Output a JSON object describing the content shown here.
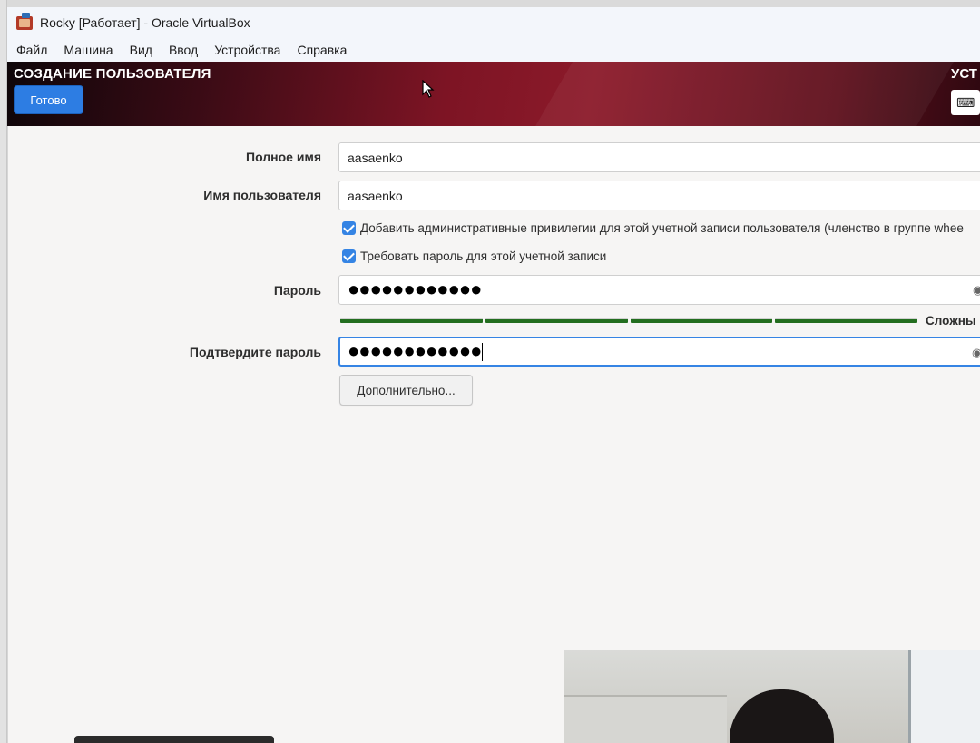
{
  "window": {
    "title": "Rocky [Работает] - Oracle VirtualBox",
    "icon": "virtualbox-icon"
  },
  "menubar": {
    "items": [
      "Файл",
      "Машина",
      "Вид",
      "Ввод",
      "Устройства",
      "Справка"
    ]
  },
  "header": {
    "title": "СОЗДАНИЕ ПОЛЬЗОВАТЕЛЯ",
    "done_label": "Готово",
    "right_title": "УСТ",
    "keyboard_label": "⌨",
    "accent_color": "#2d7de3"
  },
  "form": {
    "fullname": {
      "label": "Полное имя",
      "value": "aasaenko"
    },
    "username": {
      "label": "Имя пользователя",
      "value": "aasaenko"
    },
    "admin_checkbox": {
      "label": "Добавить административные привилегии для этой учетной записи пользователя (членство в группе whee",
      "checked": true
    },
    "require_password_checkbox": {
      "label": "Требовать пароль для этой учетной записи",
      "checked": true
    },
    "password": {
      "label": "Пароль",
      "masked_value": "●●●●●●●●●●●●"
    },
    "strength": {
      "label": "Сложны",
      "level": 1.0,
      "color": "#236e1f"
    },
    "confirm_password": {
      "label": "Подтвердите пароль",
      "masked_value": "●●●●●●●●●●●●"
    },
    "advanced_label": "Дополнительно..."
  }
}
